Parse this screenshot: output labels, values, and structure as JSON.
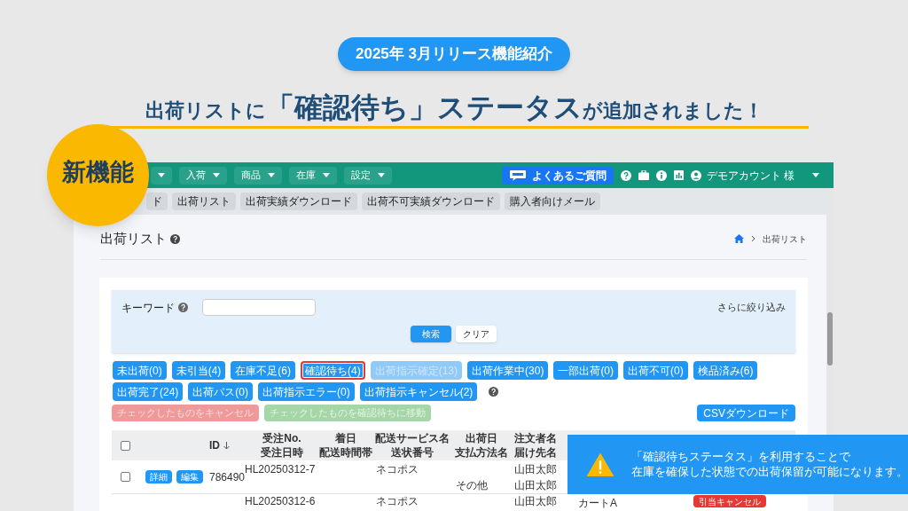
{
  "slide": {
    "release_badge": "2025年 3月リリース機能紹介",
    "headline": [
      {
        "text": "出荷リストに",
        "emphasis": false
      },
      {
        "text": "「確認待ち」ステータス",
        "emphasis": true
      },
      {
        "text": "が追加されました！",
        "emphasis": false
      }
    ],
    "new_badge": "新機能"
  },
  "navbar": {
    "menus": [
      "入荷",
      "商品",
      "在庫",
      "設定"
    ],
    "faq_button": "よくあるご質問",
    "account": "デモアカウント 様"
  },
  "subnav": [
    "ド",
    "出荷リスト",
    "出荷実績ダウンロード",
    "出荷不可実績ダウンロード",
    "購入者向けメール"
  ],
  "page": {
    "title": "出荷リスト",
    "breadcrumb": "出荷リスト"
  },
  "search": {
    "keyword_label": "キーワード",
    "more_filters": "さらに絞り込み",
    "search_button": "検索",
    "clear_button": "クリア"
  },
  "status_filters": [
    {
      "label": "未出荷(0)",
      "selected": false,
      "disabled": false
    },
    {
      "label": "未引当(4)",
      "selected": false,
      "disabled": false
    },
    {
      "label": "在庫不足(6)",
      "selected": false,
      "disabled": false
    },
    {
      "label": "確認待ち(4)",
      "selected": true,
      "disabled": false
    },
    {
      "label": "出荷指示確定(13)",
      "selected": false,
      "disabled": true
    },
    {
      "label": "出荷作業中(30)",
      "selected": false,
      "disabled": false
    },
    {
      "label": "一部出荷(0)",
      "selected": false,
      "disabled": false
    },
    {
      "label": "出荷不可(0)",
      "selected": false,
      "disabled": false
    },
    {
      "label": "検品済み(6)",
      "selected": false,
      "disabled": false
    },
    {
      "label": "出荷完了(24)",
      "selected": false,
      "disabled": false
    },
    {
      "label": "出荷パス(0)",
      "selected": false,
      "disabled": false
    },
    {
      "label": "出荷指示エラー(0)",
      "selected": false,
      "disabled": false
    },
    {
      "label": "出荷指示キャンセル(2)",
      "selected": false,
      "disabled": false
    }
  ],
  "bulk_actions": [
    {
      "label": "チェックしたものをキャンセル",
      "kind": "danger",
      "disabled": true
    },
    {
      "label": "チェックしたものを確認待ちに移動",
      "kind": "success",
      "disabled": true
    }
  ],
  "csv_button": "CSVダウンロード",
  "table": {
    "select_all": {
      "checked": false
    },
    "id_column": "ID",
    "columns": [
      {
        "top": "受注No.",
        "bottom": "受注日時"
      },
      {
        "top": "着日",
        "bottom": "配送時間帯"
      },
      {
        "top": "配送サービス名",
        "bottom": "送状番号"
      },
      {
        "top": "出荷日",
        "bottom": "支払方法名"
      },
      {
        "top": "注文者名",
        "bottom": "届け先名"
      }
    ],
    "rows": [
      {
        "checked": false,
        "buttons": [
          "詳細",
          "編集"
        ],
        "id": "786490",
        "cells": [
          [
            "HL20250312-7",
            ""
          ],
          [
            "",
            ""
          ],
          [
            "ネコポス",
            ""
          ],
          [
            "",
            "その他"
          ],
          [
            "山田太郎",
            "山田太郎"
          ]
        ]
      },
      {
        "cells": [
          [
            "HL20250312-6"
          ],
          [
            ""
          ],
          [
            "ネコポス"
          ],
          [
            ""
          ],
          [
            "山田太郎"
          ]
        ],
        "product": "カートA",
        "action": "引当キャンセル"
      }
    ]
  },
  "callout": [
    "「確認待ちステータス」を利用することで",
    "在庫を確保した状態での出荷保留が可能になります。"
  ]
}
